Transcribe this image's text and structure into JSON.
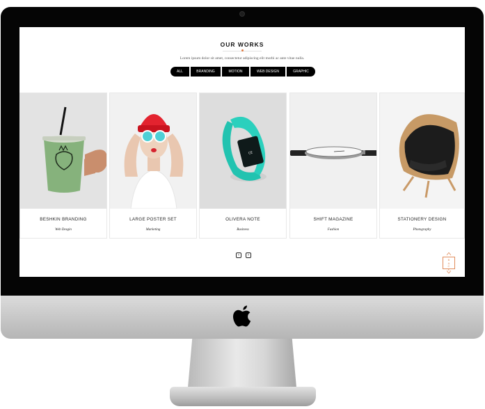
{
  "works": {
    "title": "OUR WORKS",
    "subtitle": "Lorem ipsum dolor sit amet, consectetur adipiscing elit morbi ac ante vitae nulla.",
    "filters": [
      "ALL",
      "BRANDING",
      "MOTION",
      "WEB DESIGN",
      "GRAPHIC"
    ]
  },
  "cards": [
    {
      "title": "BESHKIN BRANDING",
      "category": "Web Desgin",
      "image": "green-smoothie-cup"
    },
    {
      "title": "LARGE POSTER SET",
      "category": "Marketing",
      "image": "woman-red-beanie-sunglasses"
    },
    {
      "title": "OLIVERA NOTE",
      "category": "Business",
      "image": "teal-fitness-band"
    },
    {
      "title": "SHIFT MAGAZINE",
      "category": "Fashion",
      "image": "minimal-wristwatch"
    },
    {
      "title": "STATIONERY DESIGN",
      "category": "Photography",
      "image": "wooden-lounge-chair"
    }
  ],
  "pagination": {
    "prev_icon": "chevron-left-icon",
    "next_icon": "chevron-right-icon"
  },
  "back_to_top": {
    "label": "BACK"
  },
  "colors": {
    "accent": "#e08b5a",
    "filter_bg": "#000000",
    "watch_band_teal": "#22c3b0"
  }
}
